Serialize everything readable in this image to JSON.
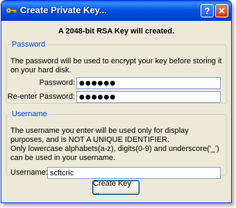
{
  "window": {
    "title": "Create Private Key...",
    "help_label": "?",
    "close_label": "✕",
    "icon": "key-icon"
  },
  "header": {
    "text": "A 2048-bit RSA Key will created."
  },
  "password_group": {
    "legend": "Password",
    "description": "The password will be used to encrypt your key before storing it on your hard disk.",
    "password_label": "Password:",
    "password_value": "●●●●●●",
    "reenter_label": "Re-enter Password:",
    "reenter_value": "●●●●●●"
  },
  "username_group": {
    "legend": "Username",
    "description": "The username you enter will be used only for display purposes, and is NOT A UNIQUE IDENTIFIER.",
    "rules": "Only lowercase alphabets(a-z), digits(0-9) and underscore('_') can be used in your username.",
    "username_label": "Username:",
    "username_value": "scftcric"
  },
  "actions": {
    "create_label": "Create Key ..."
  }
}
